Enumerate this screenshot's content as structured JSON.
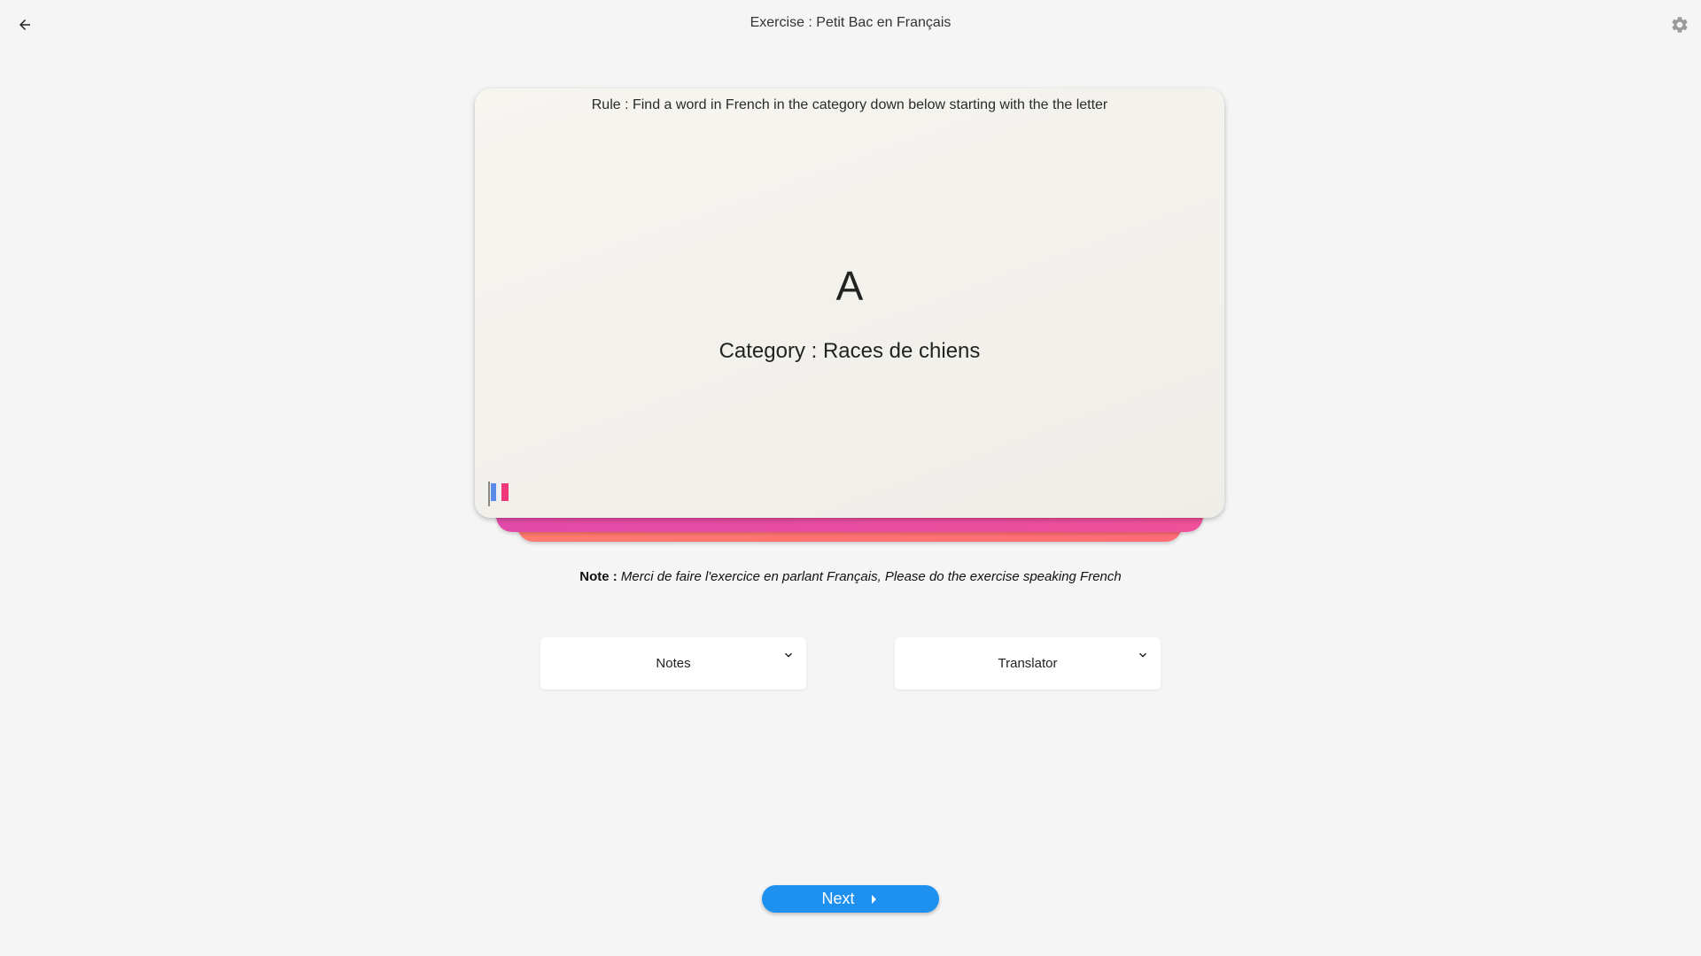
{
  "header": {
    "title": "Exercise : Petit Bac en Français",
    "back_icon": "arrow-left-icon",
    "settings_icon": "gear-icon"
  },
  "card": {
    "rule": "Rule : Find a word in French in the category down below starting with the the letter",
    "letter": "A",
    "category": "Category : Races de chiens",
    "flag_icon": "french-flag-icon"
  },
  "note": {
    "label": "Note :",
    "text": "Merci de faire l'exercice en parlant Français, Please do the exercise speaking French"
  },
  "dropdowns": [
    {
      "label": "Notes"
    },
    {
      "label": "Translator"
    }
  ],
  "next_button": {
    "label": "Next"
  },
  "colors": {
    "background": "#f5f5f5",
    "card": "#f4f2ed",
    "stack_pink": "#e94aa3",
    "stack_coral": "#ff7370",
    "next_button": "#1e90f0",
    "flag_blue": "#5b8de8",
    "flag_red": "#f0387a"
  }
}
